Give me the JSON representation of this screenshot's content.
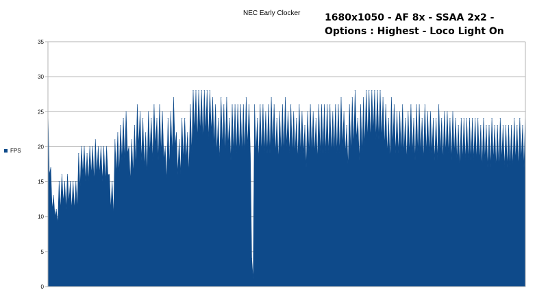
{
  "chart_data": {
    "type": "area",
    "title": "NEC Early Clocker",
    "subtitle_lines": [
      "1680x1050 - AF 8x - SSAA 2x2 -",
      "Options : Highest - Loco Light On"
    ],
    "series": [
      {
        "name": "FPS",
        "color": "#0e4a8a",
        "values": [
          25,
          17,
          13,
          11,
          15,
          16,
          15,
          16,
          15,
          15,
          15,
          19,
          20,
          20,
          19,
          20,
          20,
          21,
          20,
          20,
          20,
          20,
          16,
          15,
          21,
          22,
          23,
          24,
          25,
          20,
          21,
          23,
          26,
          25,
          24,
          22,
          25,
          24,
          26,
          24,
          26,
          25,
          20,
          24,
          25,
          27,
          22,
          21,
          24,
          24,
          22,
          26,
          28,
          28,
          28,
          28,
          28,
          28,
          28,
          27,
          26,
          24,
          27,
          26,
          27,
          24,
          26,
          26,
          26,
          26,
          26,
          27,
          26,
          4,
          26,
          24,
          26,
          26,
          25,
          26,
          27,
          26,
          24,
          25,
          26,
          27,
          25,
          26,
          25,
          24,
          26,
          25,
          23,
          25,
          26,
          25,
          24,
          26,
          26,
          26,
          26,
          26,
          25,
          26,
          26,
          27,
          25,
          23,
          26,
          27,
          28,
          24,
          26,
          27,
          28,
          28,
          28,
          28,
          28,
          28,
          27,
          26,
          24,
          27,
          26,
          25,
          25,
          26,
          24,
          25,
          26,
          24,
          26,
          26,
          24,
          26,
          25,
          25,
          24,
          24,
          26,
          24,
          25,
          25,
          24,
          25,
          24,
          23,
          24,
          24,
          24,
          24,
          24,
          24,
          24,
          23,
          24,
          23,
          23,
          24,
          23,
          23,
          24,
          23,
          23,
          23,
          23,
          24,
          23,
          24,
          23,
          25
        ],
        "dip_values": [
          16,
          11,
          10,
          9,
          11,
          12,
          11,
          12,
          11,
          11,
          11,
          14,
          16,
          15,
          15,
          16,
          15,
          16,
          16,
          15,
          15,
          16,
          11,
          10,
          16,
          16,
          18,
          18,
          19,
          15,
          16,
          17,
          20,
          18,
          17,
          16,
          19,
          18,
          20,
          18,
          19,
          18,
          15,
          17,
          19,
          20,
          16,
          16,
          18,
          18,
          16,
          19,
          22,
          21,
          22,
          21,
          22,
          21,
          22,
          20,
          19,
          18,
          20,
          19,
          20,
          18,
          19,
          19,
          19,
          19,
          19,
          20,
          19,
          1,
          19,
          18,
          19,
          19,
          19,
          19,
          20,
          19,
          18,
          19,
          19,
          20,
          19,
          19,
          19,
          18,
          19,
          19,
          17,
          19,
          19,
          19,
          18,
          19,
          19,
          19,
          19,
          19,
          19,
          19,
          19,
          20,
          19,
          17,
          19,
          20,
          21,
          18,
          19,
          20,
          21,
          21,
          22,
          21,
          21,
          21,
          20,
          19,
          18,
          20,
          19,
          19,
          19,
          19,
          18,
          19,
          19,
          18,
          19,
          19,
          18,
          19,
          19,
          19,
          18,
          18,
          19,
          18,
          19,
          19,
          18,
          19,
          18,
          17,
          18,
          18,
          18,
          18,
          18,
          18,
          18,
          17,
          18,
          17,
          17,
          18,
          17,
          17,
          18,
          17,
          17,
          17,
          17,
          18,
          17,
          18,
          17,
          18
        ]
      }
    ],
    "ylim": [
      0,
      35
    ],
    "yticks": [
      0,
      5,
      10,
      15,
      20,
      25,
      30,
      35
    ],
    "grid": true,
    "legend": "left",
    "xlabel": "",
    "ylabel": ""
  }
}
